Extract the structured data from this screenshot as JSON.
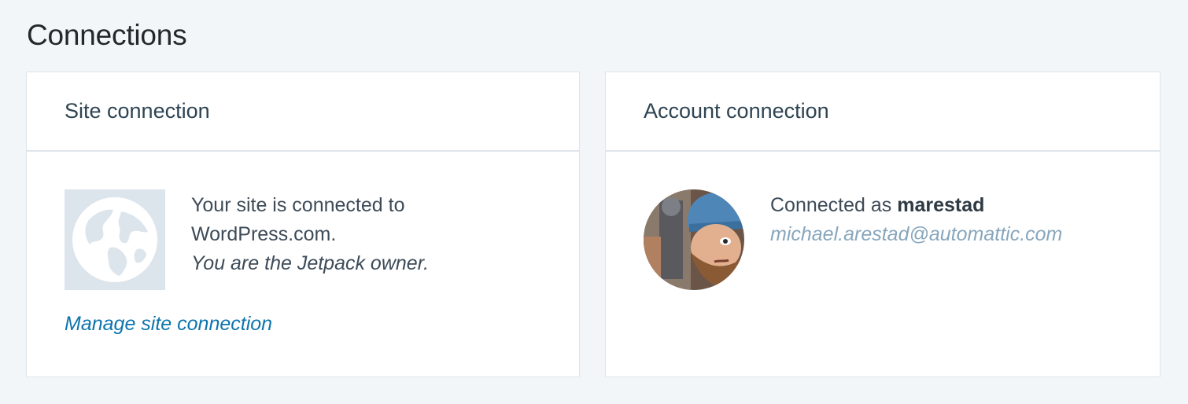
{
  "page": {
    "title": "Connections"
  },
  "site_connection": {
    "heading": "Site connection",
    "icon": "globe-icon",
    "status_line": "Your site is connected to WordPress.com.",
    "owner_line": "You are the Jetpack owner.",
    "manage_link": "Manage site connection"
  },
  "account_connection": {
    "heading": "Account connection",
    "avatar": "user-avatar",
    "connected_prefix": "Connected as",
    "username": "marestad",
    "email": "michael.arestad@automattic.com"
  },
  "colors": {
    "background": "#f3f6f8",
    "card_border": "#dde5ec",
    "link": "#0e75ad",
    "email": "#87a6bc",
    "icon_bg": "#dde5ec"
  }
}
